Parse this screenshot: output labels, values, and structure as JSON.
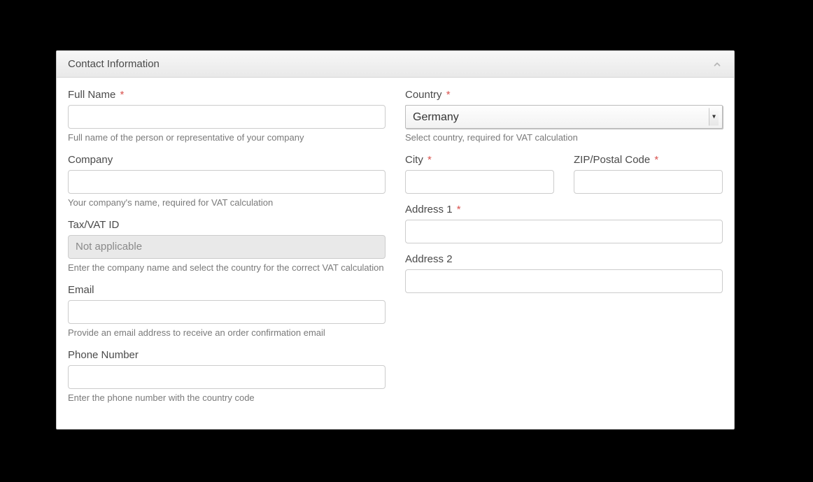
{
  "panel": {
    "title": "Contact Information"
  },
  "left": {
    "full_name": {
      "label": "Full Name",
      "required_marker": "*",
      "value": "",
      "help": "Full name of the person or representative of your company"
    },
    "company": {
      "label": "Company",
      "value": "",
      "help": "Your company's name, required for VAT calculation"
    },
    "vat": {
      "label": "Tax/VAT ID",
      "value": "Not applicable",
      "help": "Enter the company name and select the country for the correct VAT calculation"
    },
    "email": {
      "label": "Email",
      "value": "",
      "help": "Provide an email address to receive an order confirmation email"
    },
    "phone": {
      "label": "Phone Number",
      "value": "",
      "help": "Enter the phone number with the country code"
    }
  },
  "right": {
    "country": {
      "label": "Country",
      "required_marker": "*",
      "selected": "Germany",
      "help": "Select country, required for VAT calculation"
    },
    "city": {
      "label": "City",
      "required_marker": "*",
      "value": ""
    },
    "zip": {
      "label": "ZIP/Postal Code",
      "required_marker": "*",
      "value": ""
    },
    "address1": {
      "label": "Address 1",
      "required_marker": "*",
      "value": ""
    },
    "address2": {
      "label": "Address 2",
      "value": ""
    }
  }
}
